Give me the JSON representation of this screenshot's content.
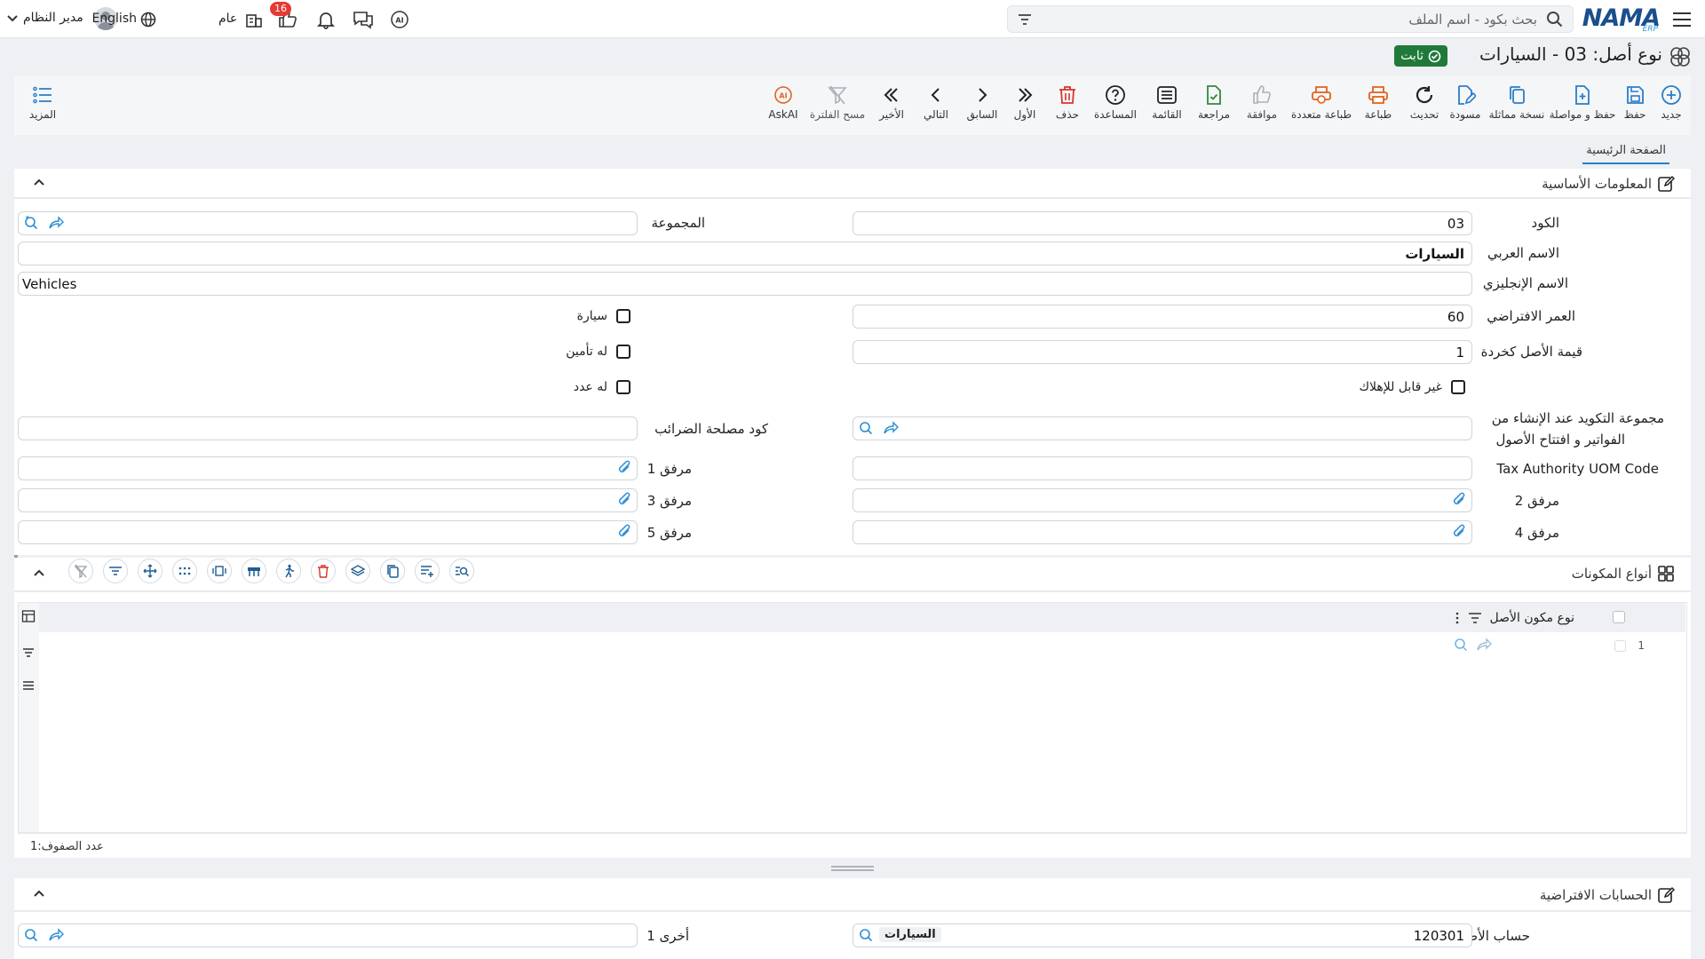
{
  "header": {
    "search_placeholder": "بحث بكود - اسم الملف",
    "logo_text": "NAMA",
    "logo_sub": "ERP",
    "user_name": "مدير النظام",
    "language": "English",
    "branch": "عام",
    "notifications_count": "16"
  },
  "page": {
    "title": "نوع أصل: 03 - السيارات",
    "status": "ثابت",
    "tab": "الصفحة الرئيسية"
  },
  "toolbar": {
    "new": "جديد",
    "save": "حفظ",
    "save_continue": "حفظ و مواصلة",
    "duplicate": "نسخة مماثلة",
    "draft": "مسودة",
    "refresh": "تحديث",
    "print": "طباعة",
    "multi_print": "طباعة متعددة",
    "approve": "موافقة",
    "review": "مراجعة",
    "list": "القائمة",
    "help": "المساعدة",
    "delete": "حذف",
    "first": "الأول",
    "previous": "السابق",
    "next": "التالي",
    "last": "الأخير",
    "clear_filter": "مسح الفلترة",
    "askai": "AskAI",
    "more": "المزيد"
  },
  "basic_info": {
    "title": "المعلومات الأساسية",
    "code_label": "الكود",
    "code_value": "03",
    "group_label": "المجموعة",
    "group_value": "",
    "arabic_name_label": "الاسم العربي",
    "arabic_name_value": "السيارات",
    "english_name_label": "الاسم الإنجليزي",
    "english_name_value": "Vehicles",
    "default_life_label": "العمر الافتراضي",
    "default_life_value": "60",
    "scrap_value_label": "قيمة الأصل كخردة",
    "scrap_value_value": "1",
    "car_label": "سيارة",
    "insurance_label": "له تأمين",
    "meter_label": "له عدد",
    "non_depreciable_label": "غير قابل للإهلاك",
    "confirm_group_label_1": "مجموعة التكويد عند الإنشاء من",
    "confirm_group_label_2": "الفواتير و افتتاح الأصول",
    "tax_code_label": "كود مصلحة الضرائب",
    "tax_uom_label": "Tax Authority UOM Code",
    "attach1_label": "مرفق 1",
    "attach2_label": "مرفق 2",
    "attach3_label": "مرفق 3",
    "attach4_label": "مرفق 4",
    "attach5_label": "مرفق 5"
  },
  "components": {
    "title": "أنواع المكونات",
    "column_header": "نوع مكون الأصل",
    "row_number": "1",
    "rows_count_label": "عدد الصفوف:",
    "rows_count": "1"
  },
  "default_accounts": {
    "title": "الحسابات الافتراضية",
    "asset_account_label": "حساب الأصل",
    "asset_account_code": "120301",
    "asset_account_name": "السيارات",
    "other1_label": "أخرى 1"
  },
  "colors": {
    "accent": "#2a7dc9",
    "status_green": "#1f7a3a",
    "badge_red": "#e53935",
    "orange_icon": "#e0621d"
  }
}
